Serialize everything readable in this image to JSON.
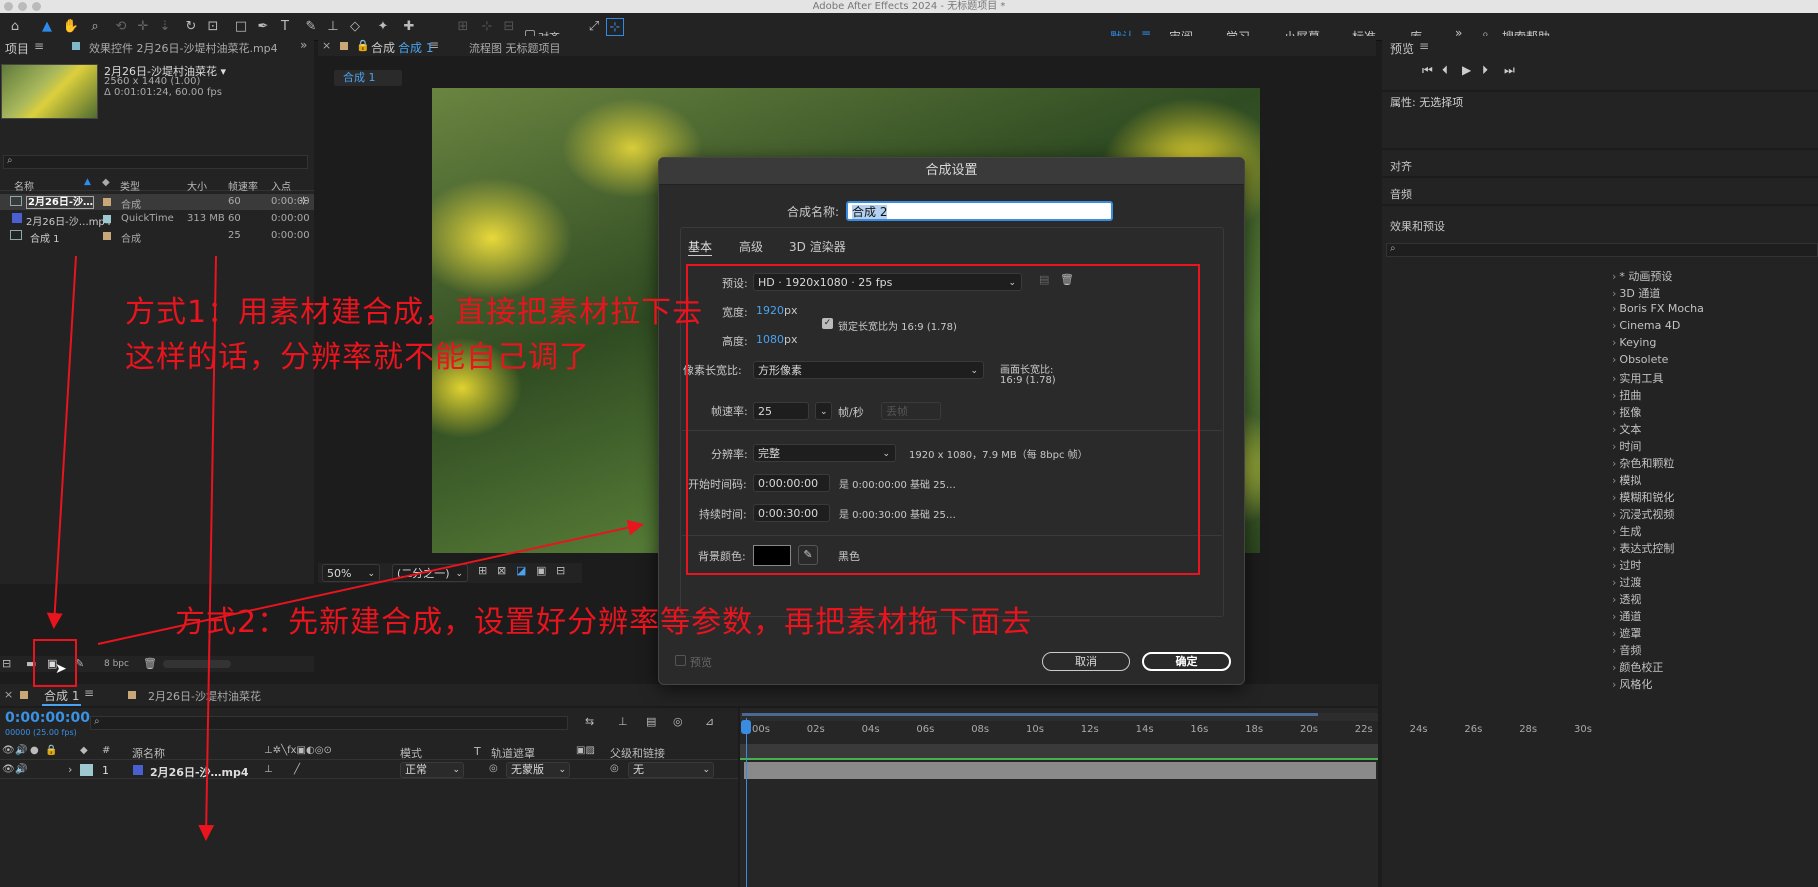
{
  "window": {
    "title": "Adobe After Effects 2024 - 无标题项目 *"
  },
  "toolbar": {
    "align_label": "对齐",
    "workspaces": [
      "默认",
      "审阅",
      "学习",
      "小屏幕",
      "标准",
      "库"
    ],
    "search_help": "搜索帮助"
  },
  "project": {
    "tab": "项目",
    "effects_tab": "效果控件 2月26日-沙堤村油菜花.mp4",
    "thumb_name": "2月26日-沙堤村油菜花 ▾",
    "thumb_res": "2560 x 1440 (1.00)",
    "thumb_dur": "Δ 0:01:01:24, 60.00 fps",
    "search_placeholder": "",
    "columns": [
      "名称",
      "类型",
      "大小",
      "帧速率",
      "入点"
    ],
    "rows": [
      {
        "name": "2月26日-沙…",
        "type": "合成",
        "size": "",
        "fps": "60",
        "in": "0:00:00"
      },
      {
        "name": "2月26日-沙…mp4",
        "type": "QuickTime",
        "size": "313 MB",
        "fps": "60",
        "in": "0:00:00"
      },
      {
        "name": "合成 1",
        "type": "合成",
        "size": "",
        "fps": "25",
        "in": "0:00:00"
      }
    ],
    "bpc": "8 bpc"
  },
  "viewer": {
    "comp_tab": "合成",
    "comp_tab_name": "合成 1",
    "flow_tab": "流程图 无标题项目",
    "crumb": "合成 1",
    "zoom": "50%",
    "res": "(二分之一)"
  },
  "dialog": {
    "title": "合成设置",
    "name_label": "合成名称:",
    "name_value": "合成 2",
    "tabs": [
      "基本",
      "高级",
      "3D 渲染器"
    ],
    "preset_label": "预设:",
    "preset_value": "HD · 1920x1080 · 25 fps",
    "width_label": "宽度:",
    "width_value": "1920",
    "height_label": "高度:",
    "height_value": "1080",
    "px": "px",
    "lock_label": "锁定长宽比为 16:9 (1.78)",
    "par_label": "像素长宽比:",
    "par_value": "方形像素",
    "frame_aspect_label": "画面长宽比:",
    "frame_aspect_value": "16:9 (1.78)",
    "fps_label": "帧速率:",
    "fps_value": "25",
    "fps_unit": "帧/秒",
    "drop_frame": "丢帧",
    "res_label": "分辨率:",
    "res_value": "完整",
    "res_info": "1920 x 1080，7.9 MB（每 8bpc 帧）",
    "start_label": "开始时间码:",
    "start_value": "0:00:00:00",
    "start_info": "是 0:00:00:00  基础 25…",
    "dur_label": "持续时间:",
    "dur_value": "0:00:30:00",
    "dur_info": "是 0:00:30:00  基础 25…",
    "bg_label": "背景颜色:",
    "bg_name": "黑色",
    "preview_label": "预览",
    "cancel": "取消",
    "ok": "确定"
  },
  "right": {
    "preview_tab": "预览",
    "props": "属性: 无选择项",
    "align": "对齐",
    "audio": "音频",
    "effects_title": "效果和预设",
    "effects": [
      "* 动画预设",
      "3D 通道",
      "Boris FX Mocha",
      "Cinema 4D",
      "Keying",
      "Obsolete",
      "实用工具",
      "扭曲",
      "抠像",
      "文本",
      "时间",
      "杂色和颗粒",
      "模拟",
      "模糊和锐化",
      "沉浸式视频",
      "生成",
      "表达式控制",
      "过时",
      "过渡",
      "透视",
      "通道",
      "遮罩",
      "音频",
      "颜色校正",
      "风格化"
    ]
  },
  "timeline": {
    "tab": "合成 1",
    "tab2": "2月26日-沙堤村油菜花",
    "time": "0:00:00:00",
    "time_sub": "00000 (25.00 fps)",
    "col_source": "源名称",
    "col_mode": "模式",
    "col_t": "T",
    "col_matte": "轨道遮罩",
    "col_parent": "父级和链接",
    "layer_num": "1",
    "layer_name": "2月26日-沙…mp4",
    "layer_mode": "正常",
    "layer_matte": "无蒙版",
    "layer_parent": "无",
    "ruler": [
      "00s",
      "02s",
      "04s",
      "06s",
      "08s",
      "10s",
      "12s",
      "14s",
      "16s",
      "18s",
      "20s",
      "22s",
      "24s",
      "26s",
      "28s",
      "30s"
    ]
  },
  "annotations": {
    "a1_line1": "方式1：用素材建合成，直接把素材拉下去",
    "a1_line2": "这样的话，分辨率就不能自己调了",
    "a2": "方式2：先新建合成，设置好分辨率等参数，再把素材拖下面去"
  }
}
